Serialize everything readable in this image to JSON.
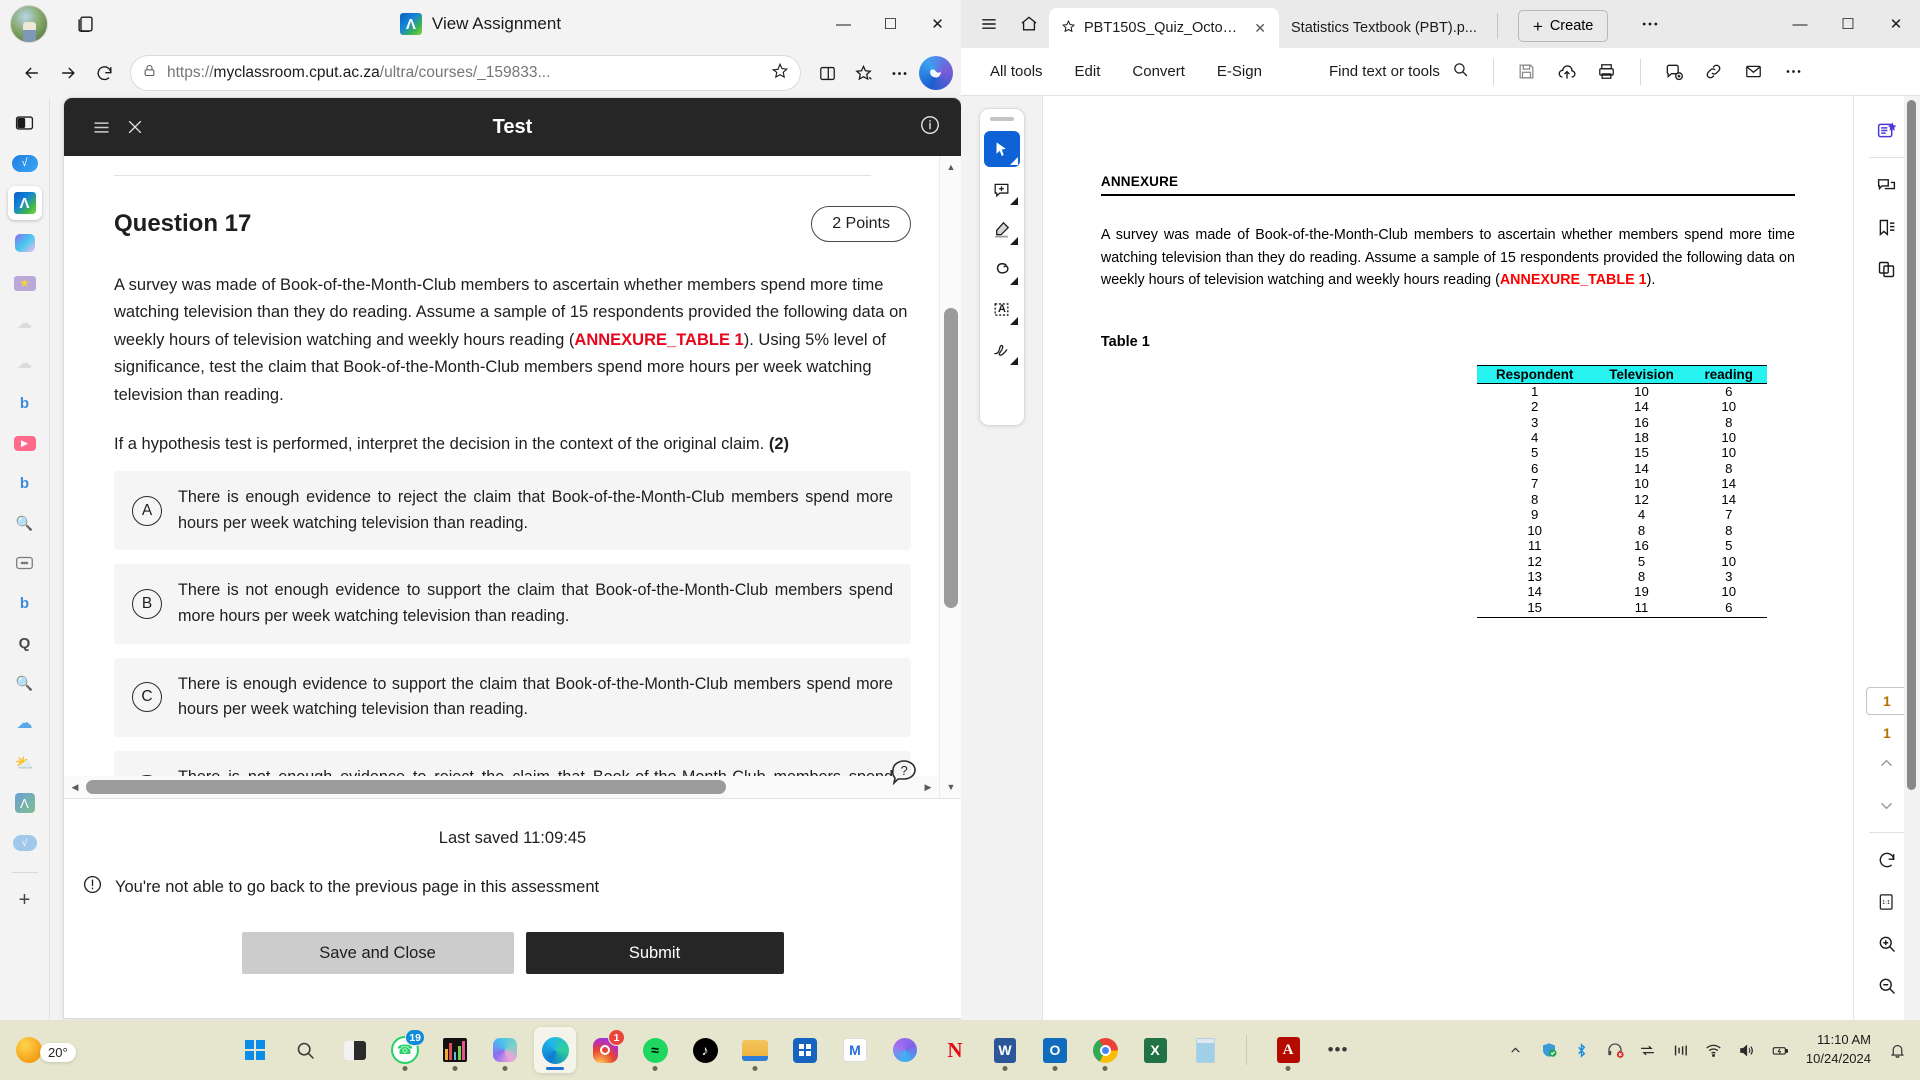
{
  "edge": {
    "window_title": "View Assignment",
    "favicon_icon": "blackboard-icon",
    "url_prefix": "https://",
    "url_bold": "myclassroom.cput.ac.za",
    "url_suffix": "/ultra/courses/_159833...",
    "url_full": "https://myclassroom.cput.ac.za/ultra/courses/_159833...",
    "controls": {
      "minimize": "—",
      "maximize": "☐",
      "close": "✕"
    },
    "toolbar_icons": [
      "back-icon",
      "forward-icon",
      "refresh-icon",
      "lock-icon",
      "favorite-star-icon",
      "split-screen-icon",
      "collections-icon",
      "settings-more-icon",
      "copilot-icon"
    ],
    "sidebar_items": [
      {
        "name": "sidebar-browser-essentials",
        "glyph": "⬜"
      },
      {
        "name": "sidebar-math-solver",
        "glyph": "√"
      },
      {
        "name": "sidebar-blackboard",
        "glyph": "Λ"
      },
      {
        "name": "sidebar-copilot",
        "glyph": "⬡"
      },
      {
        "name": "sidebar-games",
        "glyph": "★"
      },
      {
        "name": "sidebar-link-1",
        "glyph": "☁"
      },
      {
        "name": "sidebar-link-2",
        "glyph": "☁"
      },
      {
        "name": "sidebar-bing-1",
        "glyph": "b"
      },
      {
        "name": "sidebar-youtube",
        "glyph": "▶"
      },
      {
        "name": "sidebar-bing-2",
        "glyph": "b"
      },
      {
        "name": "sidebar-search-1",
        "glyph": "⚲"
      },
      {
        "name": "sidebar-wallet",
        "glyph": "▤"
      },
      {
        "name": "sidebar-bing-3",
        "glyph": "b"
      },
      {
        "name": "sidebar-quora",
        "glyph": "Q"
      },
      {
        "name": "sidebar-search-2",
        "glyph": "⚲"
      },
      {
        "name": "sidebar-onedrive",
        "glyph": "☁"
      },
      {
        "name": "sidebar-weather",
        "glyph": "⛅"
      },
      {
        "name": "sidebar-blackboard-2",
        "glyph": "Λ"
      },
      {
        "name": "sidebar-math-2",
        "glyph": "√"
      },
      {
        "name": "sidebar-add",
        "glyph": "+"
      }
    ]
  },
  "test": {
    "header_title": "Test",
    "menu_icon": "hamburger-menu-icon",
    "close_icon": "close-icon",
    "info_icon": "information-icon",
    "question_title": "Question 17",
    "points_label": "2 Points",
    "paragraph_part1": "A survey was made of Book-of-the-Month-Club members to ascertain whether members spend more time watching television than they do reading. Assume a sample of 15 respondents provided the following data on weekly hours of television watching and weekly hours reading (",
    "paragraph_red": "ANNEXURE_TABLE 1",
    "paragraph_part2": "). Using 5% level of significance, test the claim that Book-of-the-Month-Club members spend more hours per week watching television than reading.",
    "subprompt": "If a hypothesis test is performed, interpret the decision in the context of the original claim. ",
    "subprompt_marks": "(2)",
    "options": [
      {
        "letter": "A",
        "text": "There is enough evidence to reject the claim that Book-of-the-Month-Club members spend more hours per week watching television than reading."
      },
      {
        "letter": "B",
        "text": "There is not enough evidence to support the claim that Book-of-the-Month-Club members spend more hours per week watching television than reading."
      },
      {
        "letter": "C",
        "text": "There is enough evidence to support the claim that Book-of-the-Month-Club members spend more hours per week watching television than reading."
      },
      {
        "letter": "D",
        "text": "There is not enough evidence to reject the claim that Book-of-the-Month-Club members spend more hours per week watching television than reading."
      }
    ],
    "last_saved": "Last saved 11:09:45",
    "warning": "You're not able to go back to the previous page in this assessment",
    "warning_icon": "alert-circle-icon",
    "save_label": "Save and Close",
    "submit_label": "Submit",
    "help_icon": "help-bubble-icon"
  },
  "acrobat": {
    "tabs": [
      {
        "label": "PBT150S_Quiz_October...",
        "active": true,
        "star_icon": "star-icon",
        "close_icon": "close-icon"
      },
      {
        "label": "Statistics Textbook (PBT).p...",
        "active": false
      }
    ],
    "create_label": "Create",
    "menu_icon": "hamburger-menu-icon",
    "home_icon": "home-icon",
    "more_icon": "more-options-icon",
    "controls": {
      "minimize": "—",
      "maximize": "☐",
      "close": "✕"
    },
    "menus": [
      "All tools",
      "Edit",
      "Convert",
      "E-Sign"
    ],
    "find_label": "Find text or tools",
    "find_icon": "search-icon",
    "toolbar_icons": [
      "save-icon",
      "upload-cloud-icon",
      "print-icon",
      "add-comment-icon",
      "link-icon",
      "email-icon",
      "more-icon"
    ],
    "annotation_tools": [
      "select-cursor-icon",
      "add-comment-icon",
      "highlighter-icon",
      "draw-freehand-icon",
      "text-box-icon",
      "signature-icon"
    ],
    "right_tools": [
      "convert-pdf-icon",
      "comment-icon",
      "bookmark-icon",
      "organize-pages-icon"
    ],
    "page_current": "1",
    "page_total": "1",
    "page_nav": [
      "previous-page-icon",
      "next-page-icon"
    ],
    "view_tools": [
      "rotate-icon",
      "fit-page-icon",
      "zoom-in-icon",
      "zoom-out-icon"
    ],
    "document": {
      "heading": "ANNEXURE",
      "paragraph_part1": "A survey was made of Book-of-the-Month-Club members to ascertain whether members spend more time watching television than they do reading. Assume a sample of 15 respondents provided the following data on weekly hours of television watching and weekly hours reading (",
      "paragraph_red": "ANNEXURE_TABLE 1",
      "paragraph_part2": ").",
      "table_caption": "Table 1"
    }
  },
  "chart_data": {
    "type": "table",
    "title": "Table 1",
    "columns": [
      "Respondent",
      "Television",
      "reading"
    ],
    "header_bg": "#26f2f2",
    "rows": [
      [
        "1",
        "10",
        "6"
      ],
      [
        "2",
        "14",
        "10"
      ],
      [
        "3",
        "16",
        "8"
      ],
      [
        "4",
        "18",
        "10"
      ],
      [
        "5",
        "15",
        "10"
      ],
      [
        "6",
        "14",
        "8"
      ],
      [
        "7",
        "10",
        "14"
      ],
      [
        "8",
        "12",
        "14"
      ],
      [
        "9",
        "4",
        "7"
      ],
      [
        "10",
        "8",
        "8"
      ],
      [
        "11",
        "16",
        "5"
      ],
      [
        "12",
        "5",
        "10"
      ],
      [
        "13",
        "8",
        "3"
      ],
      [
        "14",
        "19",
        "10"
      ],
      [
        "15",
        "11",
        "6"
      ]
    ]
  },
  "taskbar": {
    "weather_temp": "20°",
    "apps": [
      {
        "name": "start-button",
        "label": "Start"
      },
      {
        "name": "search-button",
        "label": "Search"
      },
      {
        "name": "task-view-button",
        "label": "Task View"
      },
      {
        "name": "whatsapp-app",
        "label": "WhatsApp",
        "badge": "19",
        "running": true
      },
      {
        "name": "charts-app",
        "label": "Charts",
        "running": true
      },
      {
        "name": "copilot-app",
        "label": "Copilot",
        "running": true
      },
      {
        "name": "edge-app",
        "label": "Microsoft Edge",
        "focused": true
      },
      {
        "name": "instagram-app",
        "label": "Instagram",
        "badge": "1"
      },
      {
        "name": "spotify-app",
        "label": "Spotify",
        "running": true
      },
      {
        "name": "tiktok-app",
        "label": "TikTok"
      },
      {
        "name": "file-explorer-app",
        "label": "File Explorer",
        "running": true
      },
      {
        "name": "microsoft-store-app",
        "label": "Microsoft Store"
      },
      {
        "name": "mail-app",
        "label": "Mail"
      },
      {
        "name": "copilot-2-app",
        "label": "Copilot"
      },
      {
        "name": "netflix-app",
        "label": "Netflix"
      },
      {
        "name": "word-app",
        "label": "Microsoft Word",
        "running": true
      },
      {
        "name": "outlook-app",
        "label": "Outlook",
        "running": true
      },
      {
        "name": "chrome-app",
        "label": "Google Chrome",
        "running": true
      },
      {
        "name": "excel-app",
        "label": "Microsoft Excel"
      },
      {
        "name": "notepad-app",
        "label": "Notepad"
      },
      {
        "name": "acrobat-app",
        "label": "Adobe Acrobat",
        "running": true
      },
      {
        "name": "taskbar-overflow-button",
        "label": "•••"
      }
    ],
    "tray": [
      {
        "name": "show-hidden-icons-button",
        "glyph": "∧"
      },
      {
        "name": "windows-security-icon",
        "glyph": "⛨"
      },
      {
        "name": "bluetooth-icon",
        "glyph": "ᛗ"
      },
      {
        "name": "headset-muted-icon",
        "glyph": "⊘"
      },
      {
        "name": "network-adapter-icon",
        "glyph": "⇄"
      },
      {
        "name": "equalizer-icon",
        "glyph": "‖"
      },
      {
        "name": "wifi-icon",
        "glyph": "◞"
      },
      {
        "name": "volume-icon",
        "glyph": "ᴘ"
      },
      {
        "name": "battery-icon",
        "glyph": "▭"
      }
    ],
    "time": "11:10 AM",
    "date": "10/24/2024",
    "notification_icon": "bell-icon"
  }
}
